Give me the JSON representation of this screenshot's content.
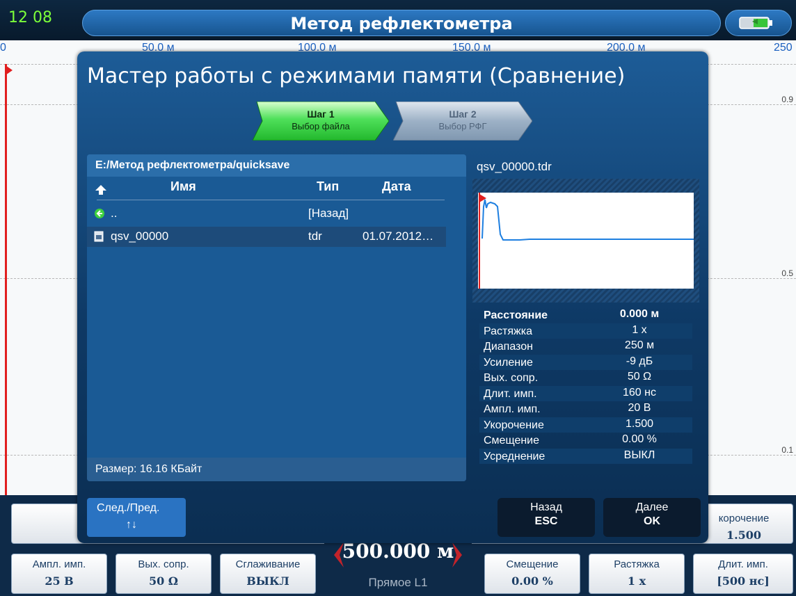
{
  "header": {
    "time": "12 08",
    "title": "Метод рефлектометра"
  },
  "scale": {
    "labels": [
      "0",
      "50.0 м",
      "100.0 м",
      "150.0 м",
      "200.0 м",
      "250"
    ]
  },
  "grid": {
    "labels": [
      "0.9",
      "0.5",
      "0.1"
    ]
  },
  "dialog": {
    "title": "Мастер работы с режимами памяти (Сравнение)",
    "steps": [
      {
        "title": "Шаг 1",
        "subtitle": "Выбор файла",
        "active": true
      },
      {
        "title": "Шаг 2",
        "subtitle": "Выбор РФГ",
        "active": false
      }
    ],
    "path": "E:/Метод рефлектометра/quicksave",
    "columns": {
      "name": "Имя",
      "type": "Тип",
      "date": "Дата"
    },
    "rows": [
      {
        "name": "..",
        "type": "[Назад]",
        "date": ""
      },
      {
        "name": "qsv_00000",
        "type": "tdr",
        "date": "01.07.2012…"
      }
    ],
    "size": "Размер: 16.16 КБайт",
    "preview_name": "qsv_00000.tdr",
    "params": [
      {
        "k": "Расстояние",
        "v": "0.000 м"
      },
      {
        "k": "Растяжка",
        "v": "1 x"
      },
      {
        "k": "Диапазон",
        "v": "250 м"
      },
      {
        "k": "Усиление",
        "v": "-9 дБ"
      },
      {
        "k": "Вых. сопр.",
        "v": "50 Ω"
      },
      {
        "k": "Длит. имп.",
        "v": "160 нс"
      },
      {
        "k": "Ампл. имп.",
        "v": "20 В"
      },
      {
        "k": "Укорочение",
        "v": "1.500"
      },
      {
        "k": "Смещение",
        "v": "0.00 %"
      },
      {
        "k": "Усреднение",
        "v": "ВЫКЛ"
      }
    ],
    "buttons": {
      "nav_label": "След./Пред.",
      "nav_arrows": "↑↓",
      "back_label": "Назад",
      "back_key": "ESC",
      "next_label": "Далее",
      "next_key": "OK"
    }
  },
  "softkeys": {
    "top_right": {
      "label": "корочение",
      "value": "1.500"
    },
    "bottom": [
      {
        "label": "Ампл. имп.",
        "value": "25 В"
      },
      {
        "label": "Вых. сопр.",
        "value": "50 Ω"
      },
      {
        "label": "Сглаживание",
        "value": "ВЫКЛ"
      },
      {
        "label": "Смещение",
        "value": "0.00 %"
      },
      {
        "label": "Растяжка",
        "value": "1 x"
      },
      {
        "label": "Длит. имп.",
        "value": "[500 нс]"
      }
    ],
    "center": {
      "value": "500.000 м",
      "mode": "Прямое L1"
    }
  },
  "colors": {
    "accent": "#2a73c2",
    "active_step": "#2bd33a",
    "marker": "#e11f1f",
    "trace": "#1e7fe0"
  }
}
